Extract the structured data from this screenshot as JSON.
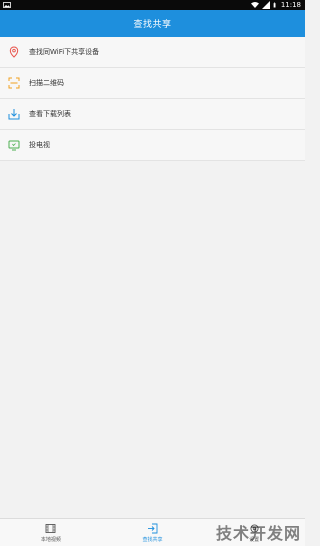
{
  "status_bar": {
    "time": "11:18",
    "icons": [
      "photo-icon",
      "wifi-icon",
      "signal-icon",
      "battery-icon"
    ]
  },
  "app_bar": {
    "title": "查找共享",
    "color": "#1e8fdd"
  },
  "menu": {
    "items": [
      {
        "label": "查找同WiFi下共享设备",
        "icon": "location-pin-icon",
        "icon_color": "#e8524a"
      },
      {
        "label": "扫描二维码",
        "icon": "scan-frame-icon",
        "icon_color": "#f0a020"
      },
      {
        "label": "查看下载列表",
        "icon": "download-tray-icon",
        "icon_color": "#1e8fdd"
      },
      {
        "label": "投电视",
        "icon": "tv-icon",
        "icon_color": "#4caf50"
      }
    ]
  },
  "bottom_nav": {
    "tabs": [
      {
        "label": "本地视频",
        "icon": "film-icon",
        "active": false
      },
      {
        "label": "查找共享",
        "icon": "share-enter-icon",
        "active": true
      },
      {
        "label": "设置",
        "icon": "settings-icon",
        "active": false
      }
    ],
    "active_color": "#1e8fdd"
  },
  "watermark": {
    "text": "技术开发网"
  }
}
